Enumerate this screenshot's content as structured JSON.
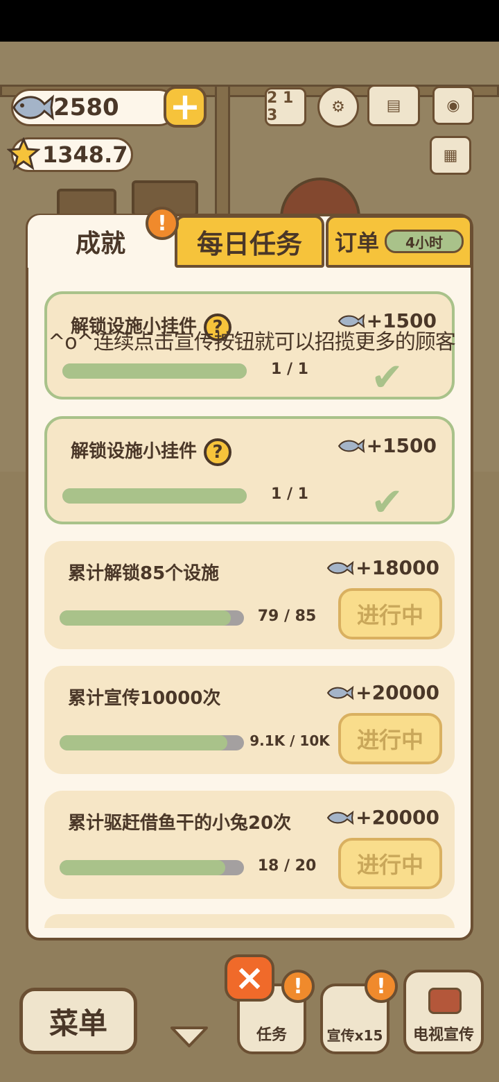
{
  "currency": {
    "fish": "2580",
    "stars": "1348.7"
  },
  "tabs": {
    "achievements": "成就",
    "daily_tasks": "每日任务",
    "orders": "订单",
    "orders_timer": "4小时"
  },
  "badge_mark": "!",
  "toast": "^o^连续点击宣传按钮就可以招揽更多的顾客",
  "achievements": [
    {
      "title": "解锁设施小挂件",
      "help": "?",
      "reward": "+1500",
      "progress_text": "1  /  1",
      "progress": 1.0,
      "status": "done"
    },
    {
      "title": "解锁设施小挂件",
      "help": "?",
      "reward": "+1500",
      "progress_text": "1  /  1",
      "progress": 1.0,
      "status": "done"
    },
    {
      "title": "累计解锁85个设施",
      "reward": "+18000",
      "progress_text": "79  /  85",
      "progress": 0.929,
      "status": "进行中"
    },
    {
      "title": "累计宣传10000次",
      "reward": "+20000",
      "progress_text": "9.1K / 10K",
      "progress": 0.91,
      "status": "进行中"
    },
    {
      "title": "累计驱赶借鱼干的小兔20次",
      "reward": "+20000",
      "progress_text": "18  /  20",
      "progress": 0.9,
      "status": "进行中"
    }
  ],
  "bottom": {
    "menu": "菜单",
    "tasks": "任务",
    "promote": "宣传x15",
    "tv_promote": "电视宣传",
    "close": "×"
  },
  "colors": {
    "accent_yellow": "#f6c33b",
    "progress_green": "#a9c28a",
    "outline_brown": "#6b4f32",
    "card_bg": "#f6e6c6",
    "panel_bg": "#fdf6ea",
    "alert_orange": "#f08a2c"
  },
  "icons": [
    "fish-icon",
    "star-icon",
    "plus-icon",
    "ranking-icon",
    "gear-icon",
    "book-icon",
    "camera-icon",
    "newspaper-icon",
    "help-icon",
    "check-icon",
    "close-icon",
    "tv-icon"
  ]
}
